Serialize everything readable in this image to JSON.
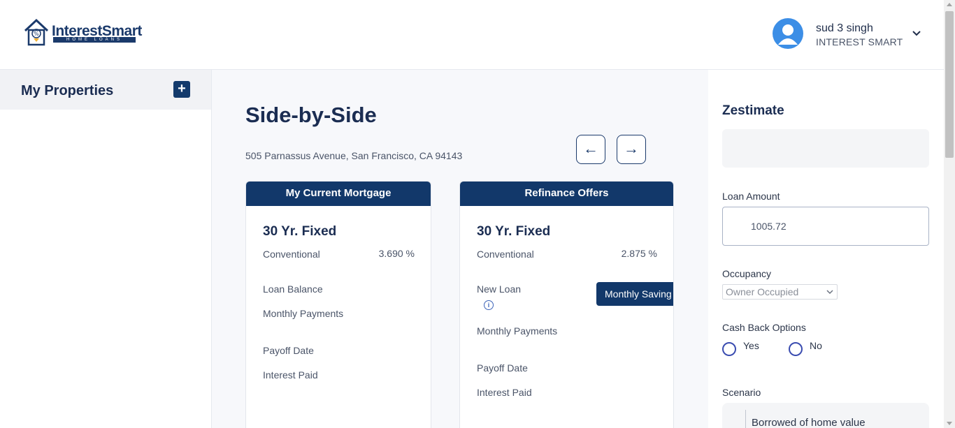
{
  "header": {
    "logo": {
      "brand": "InterestSmart",
      "sub": "HOME LOANS"
    },
    "user": {
      "name": "sud 3 singh",
      "org": "INTEREST SMART"
    }
  },
  "sidebar": {
    "title": "My Properties",
    "add_label": "+"
  },
  "main": {
    "title": "Side-by-Side",
    "address": "505 Parnassus Avenue, San Francisco, CA 94143",
    "prev_label": "←",
    "next_label": "→",
    "current_card": {
      "header": "My Current Mortgage",
      "type": "30 Yr. Fixed",
      "loan_kind": "Conventional",
      "rate": "3.690 %",
      "loan_balance_label": "Loan Balance",
      "monthly_payments_label": "Monthly Payments",
      "payoff_date_label": "Payoff Date",
      "interest_paid_label": "Interest Paid"
    },
    "refi_card": {
      "header": "Refinance Offers",
      "type": "30 Yr. Fixed",
      "loan_kind": "Conventional",
      "rate": "2.875 %",
      "new_loan_label": "New Loan",
      "info_glyph": "i",
      "saving_button": "Monthly Saving",
      "monthly_payments_label": "Monthly Payments",
      "payoff_date_label": "Payoff Date",
      "interest_paid_label": "Interest Paid"
    }
  },
  "right_panel": {
    "zestimate_title": "Zestimate",
    "loan_amount_label": "Loan Amount",
    "loan_amount_value": "1005.72",
    "occupancy_label": "Occupancy",
    "occupancy_value": "Owner Occupied",
    "cashback_label": "Cash Back Options",
    "yes_label": "Yes",
    "no_label": "No",
    "scenario_label": "Scenario",
    "scenario_text": "Borrowed of home value"
  },
  "colors": {
    "navy": "#12386a",
    "text_dark": "#1b2d52",
    "avatar_blue": "#3c8ee6",
    "radio": "#3a4cb0"
  }
}
